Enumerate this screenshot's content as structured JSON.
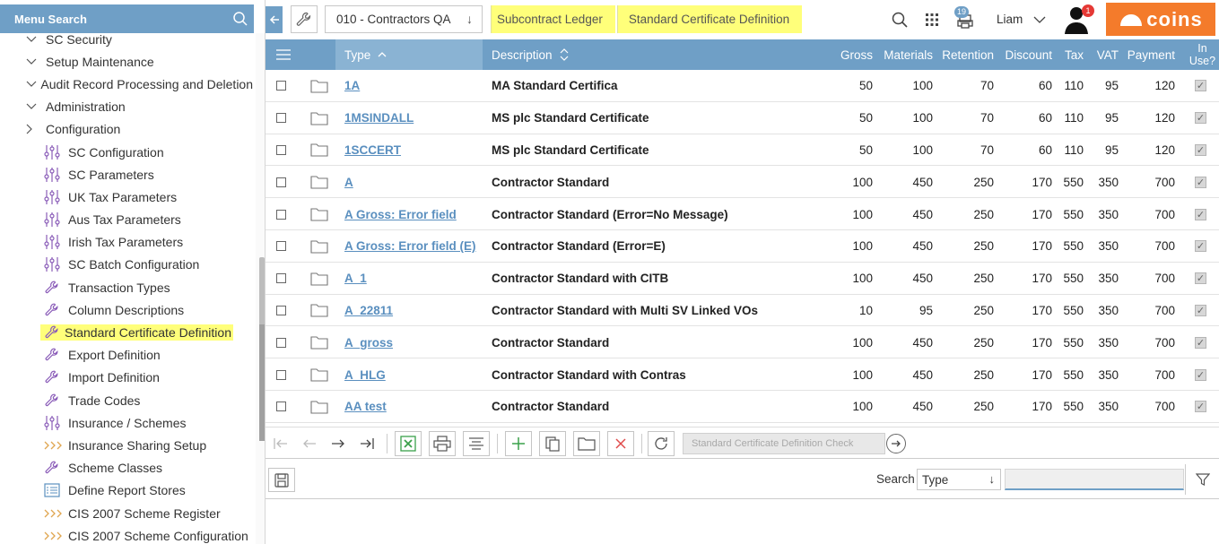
{
  "sidebar": {
    "search_label": "Menu Search",
    "items": [
      {
        "label": "SC Security",
        "kind": "top",
        "chevron": "down"
      },
      {
        "label": "Setup Maintenance",
        "kind": "top",
        "chevron": "down"
      },
      {
        "label": "Audit Record Processing and Deletion",
        "kind": "top",
        "chevron": "down"
      },
      {
        "label": "Administration",
        "kind": "top",
        "chevron": "down"
      },
      {
        "label": "Configuration",
        "kind": "top",
        "chevron": "right"
      },
      {
        "label": "SC Configuration",
        "kind": "sub",
        "icon": "sliders-icon"
      },
      {
        "label": "SC Parameters",
        "kind": "sub",
        "icon": "sliders-icon"
      },
      {
        "label": "UK Tax Parameters",
        "kind": "sub",
        "icon": "sliders-icon"
      },
      {
        "label": "Aus Tax Parameters",
        "kind": "sub",
        "icon": "sliders-icon"
      },
      {
        "label": "Irish Tax Parameters",
        "kind": "sub",
        "icon": "sliders-icon"
      },
      {
        "label": "SC Batch Configuration",
        "kind": "sub",
        "icon": "sliders-icon"
      },
      {
        "label": "Transaction Types",
        "kind": "sub",
        "icon": "wrench-icon"
      },
      {
        "label": "Column Descriptions",
        "kind": "sub",
        "icon": "wrench-icon"
      },
      {
        "label": "Standard Certificate Definition",
        "kind": "sub",
        "icon": "wrench-icon",
        "highlight": true
      },
      {
        "label": "Export Definition",
        "kind": "sub",
        "icon": "wrench-icon"
      },
      {
        "label": "Import Definition",
        "kind": "sub",
        "icon": "wrench-icon"
      },
      {
        "label": "Trade Codes",
        "kind": "sub",
        "icon": "wrench-icon"
      },
      {
        "label": "Insurance / Schemes",
        "kind": "sub",
        "icon": "sliders-icon"
      },
      {
        "label": "Insurance Sharing Setup",
        "kind": "sub",
        "icon": "chevrons-icon"
      },
      {
        "label": "Scheme Classes",
        "kind": "sub",
        "icon": "wrench-icon"
      },
      {
        "label": "Define Report Stores",
        "kind": "sub",
        "icon": "list-icon"
      },
      {
        "label": "CIS 2007 Scheme Register",
        "kind": "sub",
        "icon": "chevrons-icon"
      },
      {
        "label": "CIS 2007 Scheme Configuration",
        "kind": "sub",
        "icon": "chevrons-icon"
      }
    ]
  },
  "topbar": {
    "company": "010 - Contractors QA",
    "breadcrumbs": [
      "Subcontract Ledger",
      "Standard Certificate Definition"
    ],
    "notifications_count": "19",
    "user_name": "Liam",
    "alert_count": "1",
    "logo_text": "coins"
  },
  "grid": {
    "headers": {
      "type": "Type",
      "description": "Description",
      "gross": "Gross",
      "materials": "Materials",
      "retention": "Retention",
      "discount": "Discount",
      "tax": "Tax",
      "vat": "VAT",
      "payment": "Payment",
      "in_use_1": "In",
      "in_use_2": "Use?"
    },
    "rows": [
      {
        "type": "1A",
        "description": "MA Standard Certifica",
        "gross": "50",
        "materials": "100",
        "retention": "70",
        "discount": "60",
        "tax": "110",
        "vat": "95",
        "payment": "120",
        "in_use": true
      },
      {
        "type": "1MSINDALL",
        "description": "MS plc Standard Certificate",
        "gross": "50",
        "materials": "100",
        "retention": "70",
        "discount": "60",
        "tax": "110",
        "vat": "95",
        "payment": "120",
        "in_use": true
      },
      {
        "type": "1SCCERT",
        "description": "MS plc Standard Certificate",
        "gross": "50",
        "materials": "100",
        "retention": "70",
        "discount": "60",
        "tax": "110",
        "vat": "95",
        "payment": "120",
        "in_use": true
      },
      {
        "type": "A",
        "description": "Contractor Standard",
        "gross": "100",
        "materials": "450",
        "retention": "250",
        "discount": "170",
        "tax": "550",
        "vat": "350",
        "payment": "700",
        "in_use": true
      },
      {
        "type": "A Gross: Error field",
        "description": "Contractor Standard (Error=No Message)",
        "gross": "100",
        "materials": "450",
        "retention": "250",
        "discount": "170",
        "tax": "550",
        "vat": "350",
        "payment": "700",
        "in_use": true
      },
      {
        "type": "A Gross: Error field (E)",
        "description": "Contractor Standard (Error=E)",
        "gross": "100",
        "materials": "450",
        "retention": "250",
        "discount": "170",
        "tax": "550",
        "vat": "350",
        "payment": "700",
        "in_use": true
      },
      {
        "type": "A_1",
        "description": "Contractor Standard with CITB",
        "gross": "100",
        "materials": "450",
        "retention": "250",
        "discount": "170",
        "tax": "550",
        "vat": "350",
        "payment": "700",
        "in_use": true
      },
      {
        "type": "A_22811",
        "description": "Contractor Standard with Multi SV Linked VOs",
        "gross": "10",
        "materials": "95",
        "retention": "250",
        "discount": "170",
        "tax": "550",
        "vat": "350",
        "payment": "700",
        "in_use": true
      },
      {
        "type": "A_gross",
        "description": "Contractor Standard",
        "gross": "100",
        "materials": "450",
        "retention": "250",
        "discount": "170",
        "tax": "550",
        "vat": "350",
        "payment": "700",
        "in_use": true
      },
      {
        "type": "A_HLG",
        "description": "Contractor Standard with Contras",
        "gross": "100",
        "materials": "450",
        "retention": "250",
        "discount": "170",
        "tax": "550",
        "vat": "350",
        "payment": "700",
        "in_use": true
      },
      {
        "type": "AA test",
        "description": "Contractor Standard",
        "gross": "100",
        "materials": "450",
        "retention": "250",
        "discount": "170",
        "tax": "550",
        "vat": "350",
        "payment": "700",
        "in_use": true
      }
    ]
  },
  "toolbar": {
    "check_placeholder": "Standard Certificate Definition Check"
  },
  "bottombar": {
    "search_label": "Search",
    "search_type": "Type",
    "search_value": ""
  },
  "colors": {
    "header_blue": "#6f9fc6",
    "highlight_yellow": "#ffff7a",
    "link_blue": "#5a8fbf",
    "brand_orange": "#f47b2b",
    "icon_purple": "#8a5cb8"
  }
}
